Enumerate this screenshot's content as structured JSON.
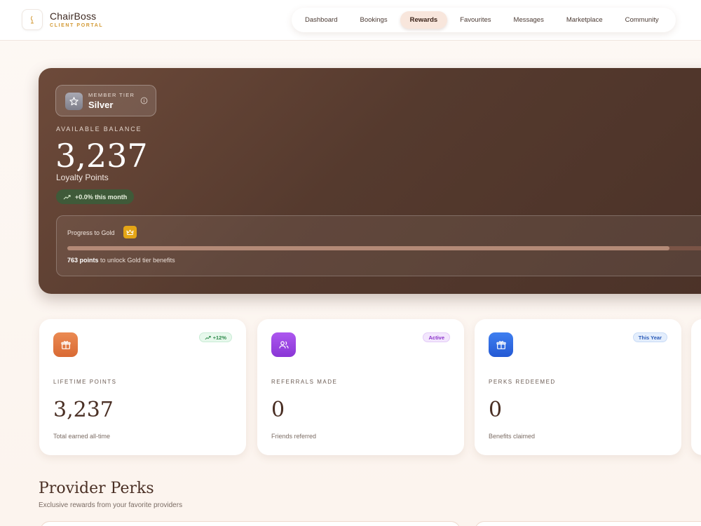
{
  "brand": {
    "name": "ChairBoss",
    "subtitle": "CLIENT PORTAL"
  },
  "nav": {
    "items": [
      {
        "label": "Dashboard",
        "active": false
      },
      {
        "label": "Bookings",
        "active": false
      },
      {
        "label": "Rewards",
        "active": true
      },
      {
        "label": "Favourites",
        "active": false
      },
      {
        "label": "Messages",
        "active": false
      },
      {
        "label": "Marketplace",
        "active": false
      },
      {
        "label": "Community",
        "active": false
      }
    ]
  },
  "hero": {
    "tier_label": "MEMBER TIER",
    "tier_value": "Silver",
    "available_label": "AVAILABLE BALANCE",
    "balance": "3,237",
    "balance_unit": "Loyalty Points",
    "trend": "+0.0% this month",
    "progress": {
      "title": "Progress to Gold",
      "fraction": 0.89,
      "points_needed": "763 points",
      "note_suffix": "to unlock Gold tier benefits"
    }
  },
  "stats": [
    {
      "label": "LIFETIME POINTS",
      "value": "3,237",
      "note": "Total earned all-time",
      "badge": "+12%",
      "icon": "gift-icon",
      "color": "#e07a43",
      "badge_bg": "#e7f8ec",
      "badge_fg": "#2f8a4b"
    },
    {
      "label": "REFERRALS MADE",
      "value": "0",
      "note": "Friends referred",
      "badge": "Active",
      "icon": "users-icon",
      "color": "#9b44e0",
      "badge_bg": "#f3e6fd",
      "badge_fg": "#8a33c9"
    },
    {
      "label": "PERKS REDEEMED",
      "value": "0",
      "note": "Benefits claimed",
      "badge": "This Year",
      "icon": "gift-icon",
      "color": "#2f6ee6",
      "badge_bg": "#e4eefc",
      "badge_fg": "#2a5bb8"
    }
  ],
  "section": {
    "title": "Provider Perks",
    "subtitle": "Exclusive rewards from your favorite providers"
  }
}
